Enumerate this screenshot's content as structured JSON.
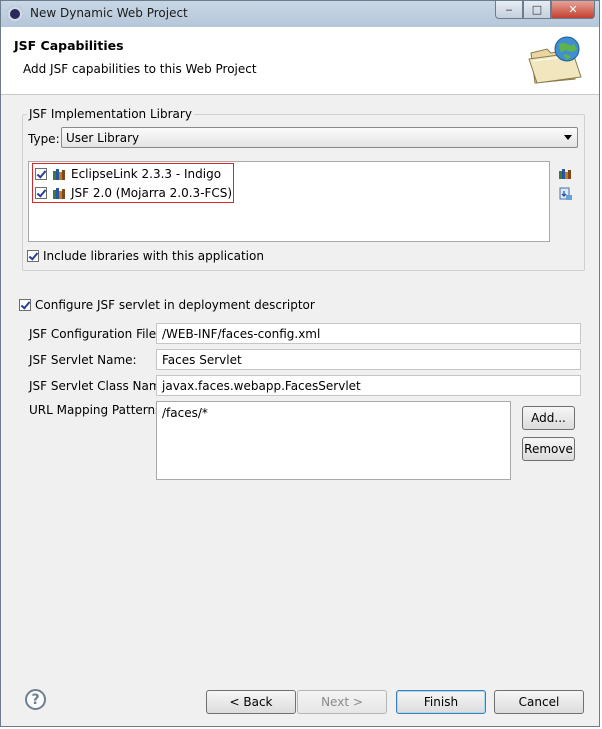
{
  "window": {
    "title": "New Dynamic Web Project",
    "controls": {
      "minimize": "‒",
      "maximize": "□",
      "close": "✕"
    }
  },
  "header": {
    "title": "JSF Capabilities",
    "description": "Add JSF capabilities to this Web Project",
    "icon": "folder-globe-icon"
  },
  "implementation": {
    "group_label": "JSF Implementation Library",
    "type_label": "Type:",
    "type_value": "User Library",
    "libraries": [
      {
        "label": "EclipseLink 2.3.3 - Indigo",
        "checked": true
      },
      {
        "label": "JSF 2.0 (Mojarra 2.0.3-FCS)",
        "checked": true
      }
    ],
    "include_label": "Include libraries with this application",
    "include_checked": true,
    "side_icons": [
      "manage-libraries-icon",
      "download-library-icon"
    ]
  },
  "servlet": {
    "configure_label": "Configure JSF servlet in deployment descriptor",
    "configure_checked": true,
    "config_file_label": "JSF Configuration File:",
    "config_file_value": "/WEB-INF/faces-config.xml",
    "servlet_name_label": "JSF Servlet Name:",
    "servlet_name_value": "Faces Servlet",
    "servlet_class_label": "JSF Servlet Class Name:",
    "servlet_class_value": "javax.faces.webapp.FacesServlet",
    "url_patterns_label": "URL Mapping Patterns:",
    "url_patterns": [
      "/faces/*"
    ],
    "add_button": "Add...",
    "remove_button": "Remove"
  },
  "footer": {
    "help_label": "?",
    "back_button": "< Back",
    "next_button": "Next >",
    "finish_button": "Finish",
    "cancel_button": "Cancel"
  },
  "colors": {
    "highlight_box": "#d9282a",
    "title_bar": "#c9d7e6",
    "dialog_bg": "#f0f0f0"
  }
}
